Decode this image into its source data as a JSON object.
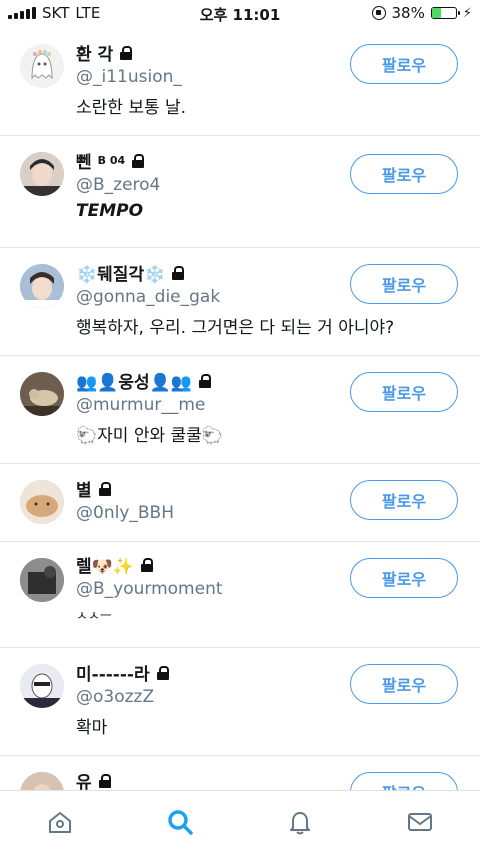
{
  "status": {
    "carrier": "SKT",
    "network": "LTE",
    "time": "오후 11:01",
    "battery_pct": "38%",
    "battery_level": 0.38
  },
  "colors": {
    "accent": "#4a99e9",
    "handle": "#657786",
    "divider": "#e1e8ed"
  },
  "rows": [
    {
      "name": "환 각",
      "handle": "@_i11usion_",
      "bio": "소란한 보통 날.",
      "avatar_color": "#f2f2f2"
    },
    {
      "name": "뻰",
      "name_sup": "B 04",
      "handle": "@B_zero4",
      "bio": "TEMPO",
      "avatar_color": "#c9b5a8"
    },
    {
      "name": "❄️뒈질각❄️",
      "handle": "@gonna_die_gak",
      "bio": "행복하자, 우리. 그거면은 다 되는 거 아니야?",
      "avatar_color": "#9fb3c9"
    },
    {
      "name": "👥👤웅성👤👥",
      "handle": "@murmur__me",
      "bio": "🐑자미 안와 쿨쿨🐑",
      "avatar_color": "#8a7a66"
    },
    {
      "name": "별",
      "handle": "@0nly_BBH",
      "bio": "",
      "avatar_color": "#d8b89a"
    },
    {
      "name": "렐🐶✨",
      "handle": "@B_yourmoment",
      "bio": "ㅅㅅㅡ",
      "avatar_color": "#6b6b6b"
    },
    {
      "name": "미------라",
      "handle": "@o3ozzZ",
      "bio": "확마",
      "avatar_color": "#e7e7ef"
    },
    {
      "name": "유",
      "handle": "",
      "bio": "",
      "avatar_color": "#cdb6a6"
    }
  ],
  "follow_label": "팔로우",
  "tabs": [
    {
      "name": "home",
      "icon": "home-icon",
      "active": false
    },
    {
      "name": "search",
      "icon": "search-icon",
      "active": true
    },
    {
      "name": "notifications",
      "icon": "bell-icon",
      "active": false
    },
    {
      "name": "messages",
      "icon": "mail-icon",
      "active": false
    }
  ]
}
